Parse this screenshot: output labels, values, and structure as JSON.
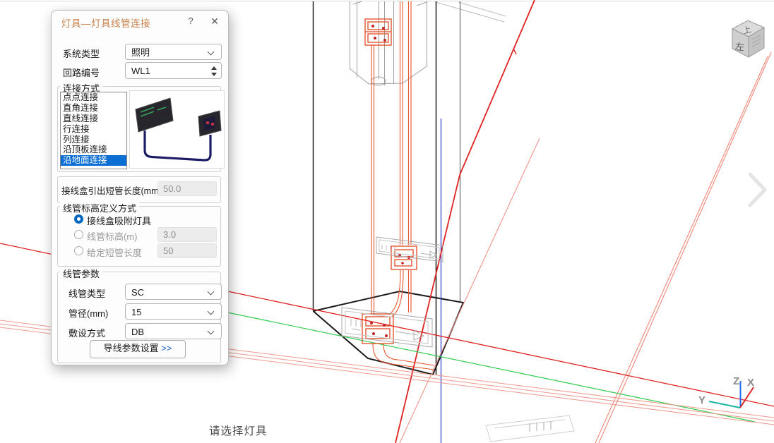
{
  "window": {
    "title": "灯具—灯具线管连接",
    "help_glyph": "?",
    "close_glyph": "✕"
  },
  "dialog": {
    "system_type": {
      "label": "系统类型",
      "value": "照明"
    },
    "circuit_number": {
      "label": "回路编号",
      "value": "WL1"
    },
    "connection_methods": {
      "legend": "连接方式",
      "items": [
        "点点连接",
        "直角连接",
        "直线连接",
        "行连接",
        "列连接",
        "沿顶板连接",
        "沿地面连接"
      ],
      "selected": "沿地面连接"
    },
    "stub_length": {
      "label": "接线盒引出短管长度(mm)",
      "value": "50.0"
    },
    "elevation_mode": {
      "legend": "线管标高定义方式",
      "radio_snap_label": "接线盒吸附灯具",
      "radio_elev_label": "线管标高(m)",
      "radio_elev_value": "3.0",
      "radio_stub_label": "给定短管长度",
      "radio_stub_value": "50",
      "selected": "接线盒吸附灯具"
    },
    "conduit_params": {
      "legend": "线管参数",
      "type_label": "线管类型",
      "type_value": "SC",
      "diameter_label": "管径(mm)",
      "diameter_value": "15",
      "laying_label": "敷设方式",
      "laying_value": "DB",
      "wire_button_label": "导线参数设置 ",
      "wire_button_arrows": ">>"
    }
  },
  "viewport": {
    "status_text": "请选择灯具",
    "view_cube": {
      "top_face": "上",
      "front_face": "左"
    },
    "axes": {
      "x": "X",
      "y": "Y",
      "z": "Z"
    },
    "colors": {
      "selection_blue": "#0a6ed2",
      "title_orange": "#c8814b",
      "axis_x_red": "#e02222",
      "axis_y_teal": "#19b5a5",
      "axis_z_blue": "#1f6bf2",
      "conduit_orange": "#e8552b",
      "grid_green": "#2ecc4e",
      "wire_red": "#e02222"
    }
  }
}
